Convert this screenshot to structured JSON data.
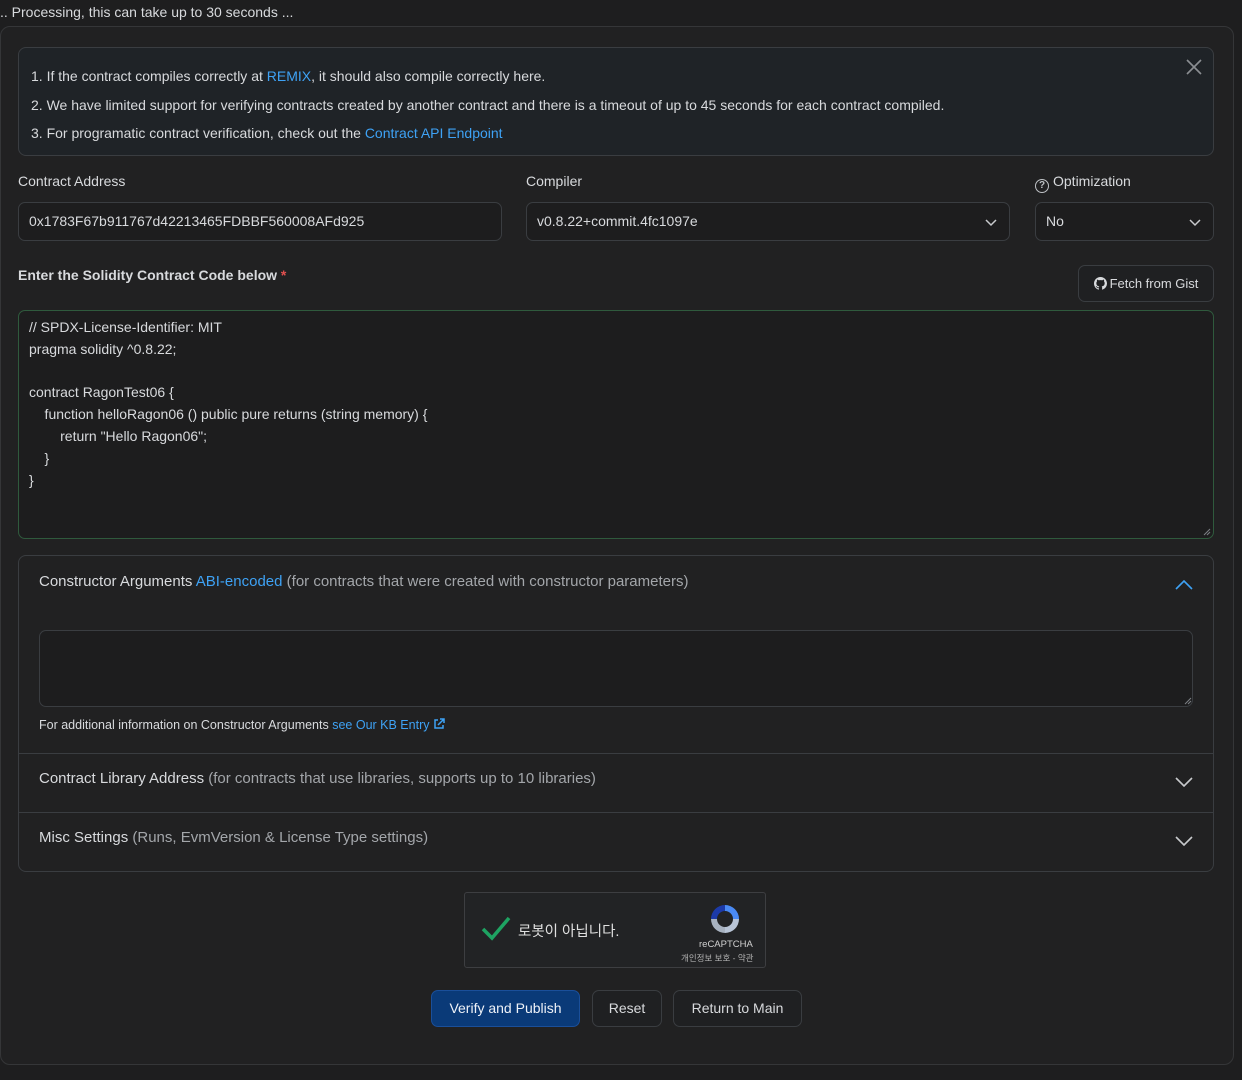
{
  "status": {
    "processing_text": ".. Processing, this can take up to 30 seconds ..."
  },
  "alert": {
    "line1_pre": "1. If the contract compiles correctly at ",
    "line1_link": "REMIX",
    "line1_post": ", it should also compile correctly here.",
    "line2": "2. We have limited support for verifying contracts created by another contract and there is a timeout of up to 45 seconds for each contract compiled.",
    "line3_pre": "3. For programatic contract verification, check out the ",
    "line3_link": "Contract API Endpoint",
    "close_icon": "close-icon"
  },
  "form": {
    "contract_address_label": "Contract Address",
    "contract_address_value": "0x1783F67b911767d42213465FDBBF560008AFd925",
    "compiler_label": "Compiler",
    "compiler_value": "v0.8.22+commit.4fc1097e",
    "optimization_label": "Optimization",
    "optimization_value": "No",
    "code_label": "Enter the Solidity Contract Code below",
    "required_mark": "*",
    "fetch_gist_label": "Fetch from Gist",
    "code_value": "// SPDX-License-Identifier: MIT\npragma solidity ^0.8.22;\n\ncontract RagonTest06 {\n    function helloRagon06 () public pure returns (string memory) {\n        return \"Hello Ragon06\";\n    }\n}"
  },
  "accordion": {
    "ctor_title": "Constructor Arguments",
    "ctor_link": "ABI-encoded",
    "ctor_desc": "(for contracts that were created with constructor parameters)",
    "ctor_note": "For additional information on Constructor Arguments",
    "ctor_note_link": "see Our KB Entry",
    "lib_title": "Contract Library Address",
    "lib_desc": "(for contracts that use libraries, supports up to 10 libraries)",
    "misc_title": "Misc Settings",
    "misc_desc": "(Runs, EvmVersion & License Type settings)"
  },
  "captcha": {
    "label": "로봇이 아닙니다.",
    "brand": "reCAPTCHA",
    "links": "개인정보 보호 - 약관"
  },
  "actions": {
    "verify_label": "Verify and Publish",
    "reset_label": "Reset",
    "return_label": "Return to Main"
  },
  "colors": {
    "link": "#3ea2f5",
    "primary_button": "#0a3a78",
    "code_border": "#2f5a3d",
    "check": "#1ea362"
  }
}
